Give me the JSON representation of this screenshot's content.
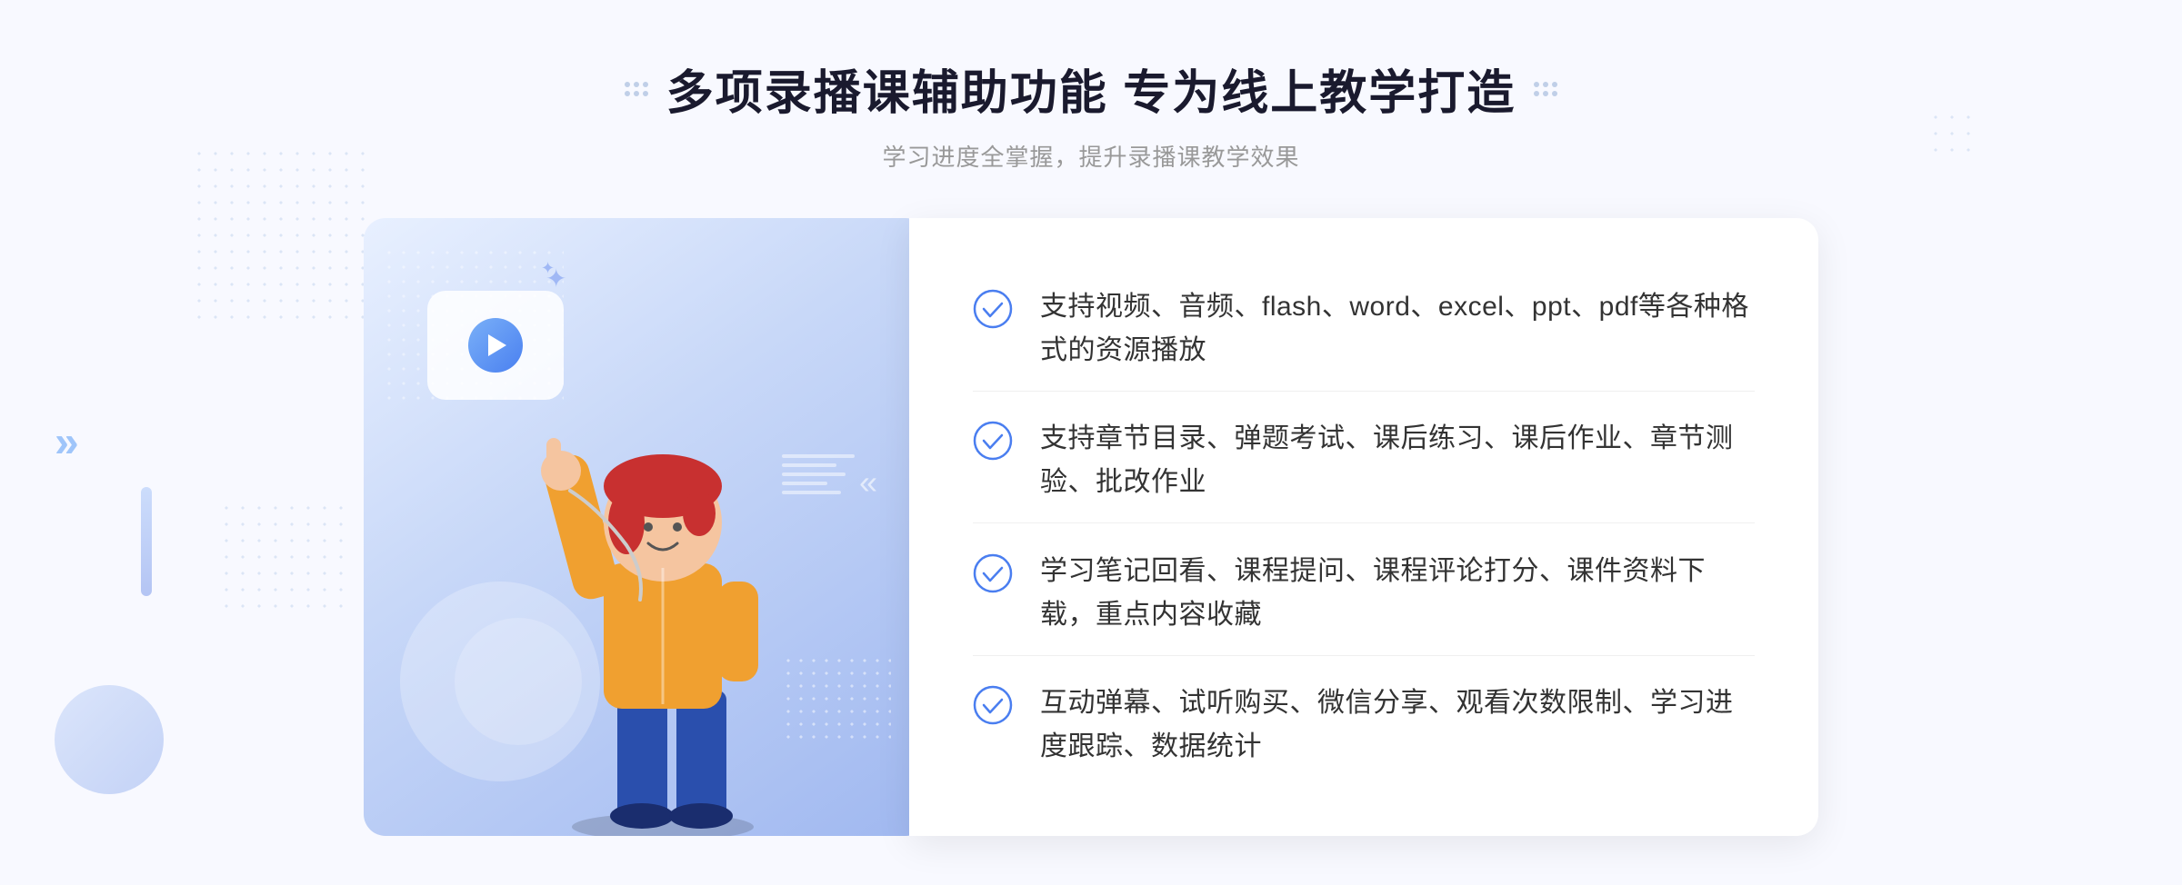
{
  "header": {
    "title": "多项录播课辅助功能 专为线上教学打造",
    "subtitle": "学习进度全掌握，提升录播课教学效果",
    "dots_decoration": "····"
  },
  "features": [
    {
      "id": 1,
      "text": "支持视频、音频、flash、word、excel、ppt、pdf等各种格式的资源播放"
    },
    {
      "id": 2,
      "text": "支持章节目录、弹题考试、课后练习、课后作业、章节测验、批改作业"
    },
    {
      "id": 3,
      "text": "学习笔记回看、课程提问、课程评论打分、课件资料下载，重点内容收藏"
    },
    {
      "id": 4,
      "text": "互动弹幕、试听购买、微信分享、观看次数限制、学习进度跟踪、数据统计"
    }
  ],
  "illustration": {
    "play_button_alt": "播放按钮"
  },
  "colors": {
    "primary_blue": "#4a7ef0",
    "light_blue": "#7ab0f8",
    "check_color": "#4a7ef0",
    "title_color": "#1a1a2e",
    "subtitle_color": "#999999",
    "text_color": "#333333"
  }
}
